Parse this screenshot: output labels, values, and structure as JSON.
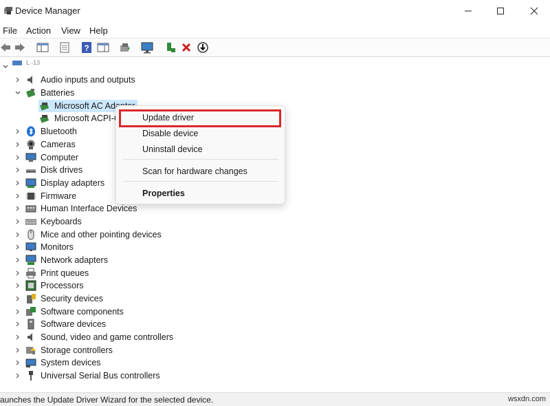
{
  "window": {
    "title": "Device Manager"
  },
  "menu": [
    "File",
    "Action",
    "View",
    "Help"
  ],
  "tree": {
    "root_label": "L   -13",
    "categories": [
      "Audio inputs and outputs",
      "Batteries",
      "Bluetooth",
      "Cameras",
      "Computer",
      "Disk drives",
      "Display adapters",
      "Firmware",
      "Human Interface Devices",
      "Keyboards",
      "Mice and other pointing devices",
      "Monitors",
      "Network adapters",
      "Print queues",
      "Processors",
      "Security devices",
      "Software components",
      "Software devices",
      "Sound, video and game controllers",
      "Storage controllers",
      "System devices",
      "Universal Serial Bus controllers"
    ],
    "battery_children": [
      "Microsoft AC Adapter",
      "Microsoft ACPI-C"
    ]
  },
  "context_menu": {
    "items": [
      "Update driver",
      "Disable device",
      "Uninstall device",
      "Scan for hardware changes",
      "Properties"
    ],
    "highlight_color": "#d9282c"
  },
  "status": {
    "text": "aunches the Update Driver Wizard for the selected device.",
    "watermark": "wsxdn.com"
  },
  "colors": {
    "selection": "#cce8ff",
    "accent_red": "#d9282c"
  }
}
